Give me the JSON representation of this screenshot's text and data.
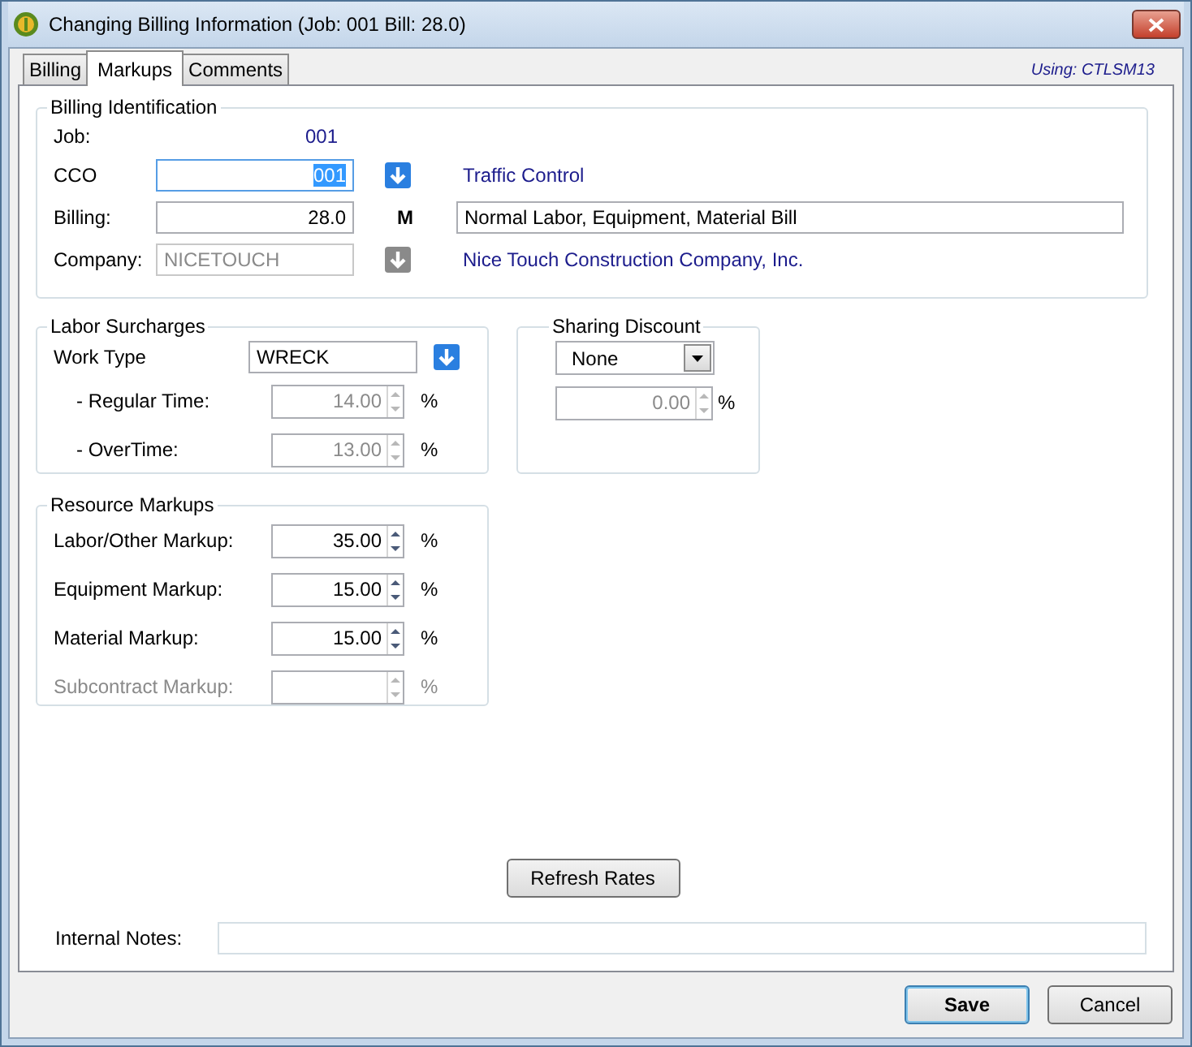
{
  "window": {
    "title": "Changing Billing Information  (Job: 001  Bill:   28.0)"
  },
  "tabs": [
    {
      "label": "Billing",
      "selected": false
    },
    {
      "label": "Markups",
      "selected": true
    },
    {
      "label": "Comments",
      "selected": false
    }
  ],
  "using_label": "Using: CTLSM13",
  "billing_identification": {
    "title": "Billing Identification",
    "job": {
      "label": "Job:",
      "value": "001"
    },
    "cco": {
      "label": "CCO",
      "value": "001",
      "text_selected": true,
      "description": "Traffic Control"
    },
    "billing": {
      "label": "Billing:",
      "value": "28.0",
      "code": "M",
      "description": "Normal Labor, Equipment, Material Bill"
    },
    "company": {
      "label": "Company:",
      "value": "NICETOUCH",
      "disabled": true,
      "description": "Nice Touch Construction Company, Inc."
    }
  },
  "labor_surcharges": {
    "title": "Labor Surcharges",
    "work_type": {
      "label": "Work Type",
      "value": "WRECK"
    },
    "rows": [
      {
        "label": "- Regular Time:",
        "value": "14.00",
        "disabled": true,
        "unit": "%"
      },
      {
        "label": "- OverTime:",
        "value": "13.00",
        "disabled": true,
        "unit": "%"
      }
    ]
  },
  "sharing_discount": {
    "title": "Sharing Discount",
    "dropdown": "None",
    "value": "0.00",
    "disabled": true,
    "unit": "%"
  },
  "resource_markups": {
    "title": "Resource Markups",
    "rows": [
      {
        "label": "Labor/Other Markup:",
        "value": "35.00",
        "disabled": false,
        "unit": "%"
      },
      {
        "label": "Equipment Markup:",
        "value": "15.00",
        "disabled": false,
        "unit": "%"
      },
      {
        "label": "Material Markup:",
        "value": "15.00",
        "disabled": false,
        "unit": "%"
      },
      {
        "label": "Subcontract Markup:",
        "disabled": true,
        "unit": "%"
      }
    ]
  },
  "refresh_button": "Refresh Rates",
  "internal_notes": {
    "label": "Internal Notes:"
  },
  "buttons": [
    {
      "label": "Save",
      "default": true
    },
    {
      "label": "Cancel",
      "default": false
    }
  ]
}
